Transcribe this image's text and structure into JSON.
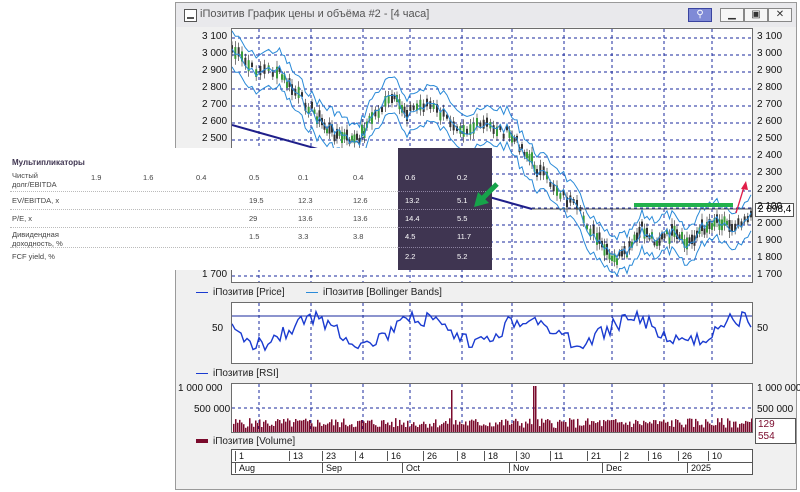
{
  "window": {
    "title": "iПозитив График цены и объёма #2 - [4 часа]",
    "buttons": [
      "link",
      "minimize",
      "restore",
      "close"
    ]
  },
  "price_panel": {
    "y_ticks": [
      "3 100",
      "3 000",
      "2 900",
      "2 800",
      "2 700",
      "2 600",
      "2 500",
      "2 400",
      "2 300",
      "2 200",
      "2 100",
      "2 000",
      "1 900",
      "1 800",
      "1 700"
    ],
    "current_value": "2 098,4",
    "legend": [
      {
        "label": "iПозитив [Price]"
      },
      {
        "label": "iПозитив [Bollinger Bands]"
      }
    ]
  },
  "rsi_panel": {
    "y_tick": "50",
    "legend": "iПозитив [RSI]"
  },
  "volume_panel": {
    "y_ticks": [
      "1 000 000",
      "500 000"
    ],
    "current_value": "129 554",
    "legend": "iПозитив [Volume]"
  },
  "time_axis": {
    "days": [
      "1",
      "13",
      "23",
      "4",
      "16",
      "26",
      "8",
      "18",
      "30",
      "11",
      "21",
      "2",
      "16",
      "26",
      "10"
    ],
    "months": [
      "Aug",
      "Sep",
      "Oct",
      "Nov",
      "Dec",
      "2025"
    ]
  },
  "multiples_table": {
    "title": "Мультипликаторы",
    "rows": [
      {
        "label": "Чистый долг/EBITDA",
        "values": [
          "1.9",
          "1.6",
          "0.4",
          "0.5",
          "0.1",
          "0.4",
          "0.6",
          "0.2"
        ]
      },
      {
        "label": "EV/EBITDA, x",
        "values": [
          "",
          "",
          "",
          "19.5",
          "12.3",
          "12.6",
          "13.2",
          "5.1"
        ]
      },
      {
        "label": "P/E, x",
        "values": [
          "",
          "",
          "",
          "29",
          "13.6",
          "13.6",
          "14.4",
          "5.5"
        ]
      },
      {
        "label": "Дивидендная доходность, %",
        "values": [
          "",
          "",
          "",
          "1.5",
          "3.3",
          "3.8",
          "4.5",
          "11.7"
        ]
      },
      {
        "label": "FCF yield, %",
        "values": [
          "",
          "",
          "",
          "",
          "",
          "",
          "2.2",
          "5.2"
        ]
      }
    ]
  },
  "colors": {
    "price": "#1a3bd0",
    "bands": "#2a8ad8",
    "volume": "#7a0a2c",
    "grid": "#1a2a9c",
    "highlight_dark": "#3f3551",
    "arrow_green": "#16a34a",
    "arrow_red": "#e11d48",
    "level_green": "#22b14c"
  },
  "icons": [
    "chart-window-icon",
    "link-icon",
    "minimize-icon",
    "restore-icon",
    "close-icon",
    "arrow-up-icon",
    "arrow-down-left-icon"
  ]
}
